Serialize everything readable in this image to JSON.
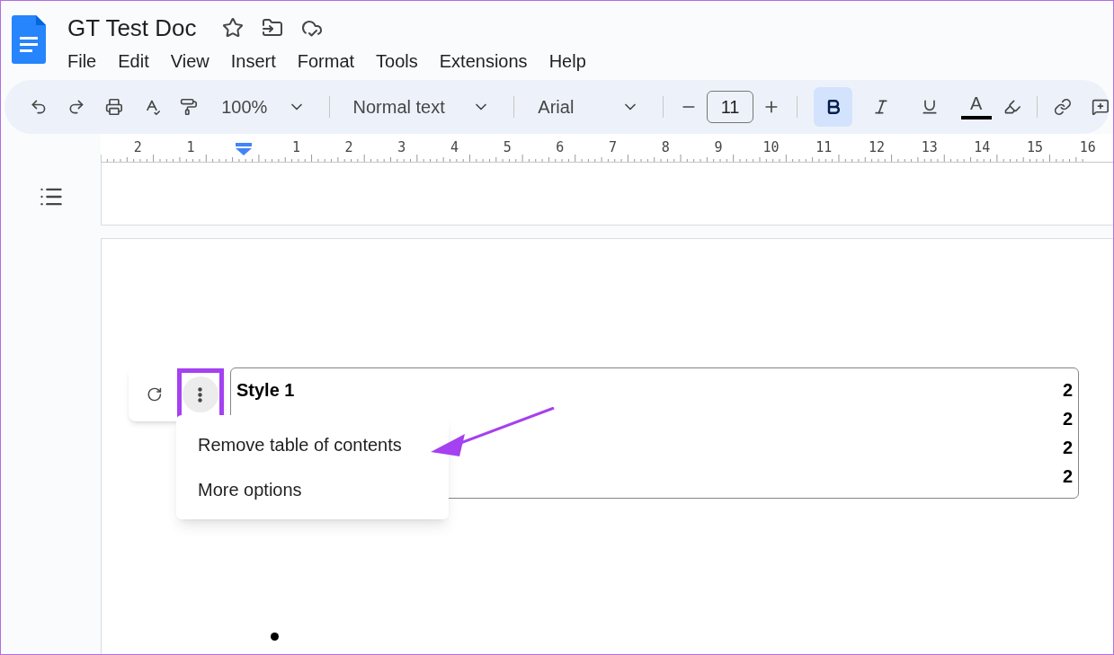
{
  "document": {
    "title": "GT Test Doc"
  },
  "menu_bar": [
    "File",
    "Edit",
    "View",
    "Insert",
    "Format",
    "Tools",
    "Extensions",
    "Help"
  ],
  "toolbar": {
    "zoom": "100%",
    "style": "Normal text",
    "font": "Arial",
    "font_size": "11",
    "bold": true,
    "italic": false,
    "underline": false,
    "text_color_label": "A"
  },
  "ruler": [
    {
      "kind": "number",
      "label": "2"
    },
    {
      "kind": "number",
      "label": "1"
    },
    {
      "kind": "indent"
    },
    {
      "kind": "number",
      "label": "1"
    },
    {
      "kind": "number",
      "label": "2"
    },
    {
      "kind": "number",
      "label": "3"
    },
    {
      "kind": "number",
      "label": "4"
    },
    {
      "kind": "number",
      "label": "5"
    },
    {
      "kind": "number",
      "label": "6"
    },
    {
      "kind": "number",
      "label": "7"
    },
    {
      "kind": "number",
      "label": "8"
    },
    {
      "kind": "number",
      "label": "9"
    },
    {
      "kind": "number",
      "label": "10"
    },
    {
      "kind": "number",
      "label": "11"
    },
    {
      "kind": "number",
      "label": "12"
    },
    {
      "kind": "number",
      "label": "13"
    },
    {
      "kind": "number",
      "label": "14"
    },
    {
      "kind": "number",
      "label": "15"
    },
    {
      "kind": "number",
      "label": "16"
    }
  ],
  "table_of_contents": [
    {
      "title": "Style 1",
      "page": "2"
    },
    {
      "page": "2"
    },
    {
      "page": "2"
    },
    {
      "page": "2"
    }
  ],
  "context_menu": [
    {
      "label": "Remove table of contents"
    },
    {
      "label": "More options"
    }
  ]
}
